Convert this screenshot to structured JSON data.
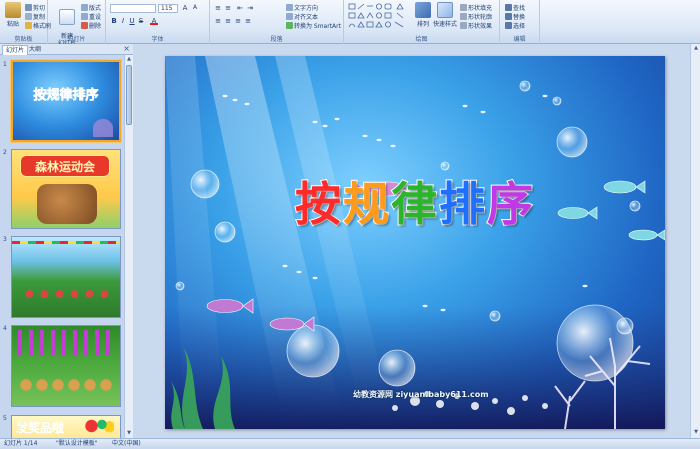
{
  "ribbon": {
    "clipboard": {
      "group_label": "剪贴板",
      "paste_label": "粘贴",
      "cut_label": "剪切",
      "copy_label": "复制",
      "format_painter_label": "格式刷"
    },
    "slides": {
      "group_label": "幻灯片",
      "new_slide_label": "新建\n幻灯片",
      "layout_label": "版式",
      "reset_label": "重设",
      "delete_label": "删除"
    },
    "font": {
      "group_label": "字体",
      "font_name": "",
      "font_size": "115"
    },
    "paragraph": {
      "group_label": "段落",
      "text_direction_label": "文字方向",
      "align_text_label": "对齐文本",
      "smartart_label": "转换为 SmartArt"
    },
    "drawing": {
      "group_label": "绘图",
      "arrange_label": "排列",
      "quick_styles_label": "快速样式",
      "shape_fill_label": "形状填充",
      "shape_outline_label": "形状轮廓",
      "shape_effects_label": "形状效果"
    },
    "editing": {
      "group_label": "编辑",
      "find_label": "查找",
      "replace_label": "替换",
      "select_label": "选择"
    }
  },
  "panel": {
    "tab_slides": "幻灯片",
    "tab_outline": "大纲",
    "close_glyph": "×",
    "thumbnails": [
      {
        "number": "1",
        "title": "按规律排序"
      },
      {
        "number": "2",
        "title": "森林运动会"
      },
      {
        "number": "3",
        "title": ""
      },
      {
        "number": "4",
        "title": ""
      },
      {
        "number": "5",
        "title": "发奖品啦"
      }
    ]
  },
  "slide": {
    "title_chars": [
      "按",
      "规",
      "律",
      "排",
      "序"
    ],
    "title_colors": [
      "#ff2a2a",
      "#ff9a1a",
      "#2bb52b",
      "#1e6fff",
      "#c238e6"
    ],
    "watermark": "幼教资源网 ziyuan.baby611.com"
  },
  "status": {
    "slide_counter": "幻灯片 1/14",
    "theme": "\"默认设计模板\"",
    "language": "中文(中国)"
  }
}
